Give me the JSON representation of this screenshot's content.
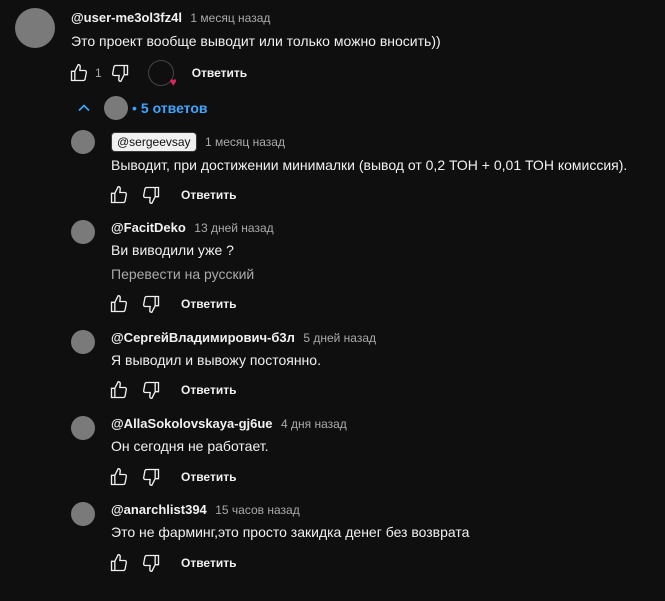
{
  "main_comment": {
    "author": "@user-me3ol3fz4l",
    "time": "1 месяц назад",
    "text": "Это проект вообще выводит или только можно вносить))",
    "likes": "1",
    "reply_label": "Ответить"
  },
  "replies_toggle": {
    "label": "5 ответов",
    "bullet": "•"
  },
  "replies": [
    {
      "author": "@sergeevsay",
      "time": "1 месяц назад",
      "text": "Выводит, при достижении минималки (вывод от 0,2 ТОН + 0,01 ТОН комиссия).",
      "reply_label": "Ответить"
    },
    {
      "author": "@FacitDeko",
      "time": "13 дней назад",
      "text": "Ви виводили уже ?",
      "translate": "Перевести на русский",
      "reply_label": "Ответить"
    },
    {
      "author": "@СергейВладимирович-б3л",
      "time": "5 дней назад",
      "text": "Я выводил и вывожу постоянно.",
      "reply_label": "Ответить"
    },
    {
      "author": "@AllaSokolovskaya-gj6ue",
      "time": "4 дня назад",
      "text": "Он сегодня не работает.",
      "reply_label": "Ответить"
    },
    {
      "author": "@anarchlist394",
      "time": "15 часов назад",
      "text": "Это не фарминг,это просто закидка денег без возврата",
      "reply_label": "Ответить"
    }
  ],
  "icons": [
    "thumb-up-icon",
    "thumb-down-icon",
    "heart-icon",
    "chevron-up-icon"
  ]
}
